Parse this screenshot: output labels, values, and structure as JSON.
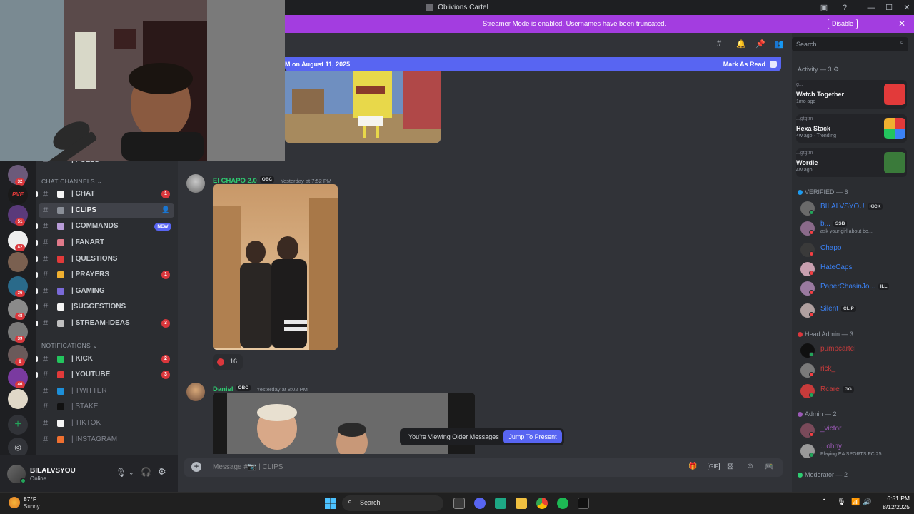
{
  "window": {
    "title": "Oblivions Cartel"
  },
  "banner": {
    "text": "Streamer Mode is enabled. Usernames have been truncated.",
    "disable_label": "Disable"
  },
  "search": {
    "placeholder": "Search"
  },
  "newbar": {
    "text": "M on August 11, 2025",
    "mark_label": "Mark As Read"
  },
  "channels": {
    "categories": [
      {
        "label": "CHAT CHANNELS ⌄"
      },
      {
        "label": "NOTIFICATIONS ⌄"
      }
    ],
    "partial_top": "| POLLS",
    "items": [
      {
        "label": "| CHAT",
        "badge": "1",
        "emoji_color": "#f5f5f5"
      },
      {
        "label": "| CLIPS",
        "emoji_color": "#8a8f98"
      },
      {
        "label": "| COMMANDS",
        "new": "NEW",
        "emoji_color": "#b89cd8"
      },
      {
        "label": "| FANART",
        "emoji_color": "#e07a8a"
      },
      {
        "label": "| QUESTIONS",
        "emoji_color": "#e23a3a"
      },
      {
        "label": "| PRAYERS",
        "badge": "1",
        "emoji_color": "#f0b030"
      },
      {
        "label": "| GAMING",
        "emoji_color": "#7a6ad8"
      },
      {
        "label": "|SUGGESTIONS",
        "emoji_color": "#f5f5f5"
      },
      {
        "label": "| STREAM-IDEAS",
        "badge": "3",
        "emoji_color": "#c0c0c0"
      },
      {
        "label": "| KICK",
        "badge": "2",
        "emoji_color": "#23c55e"
      },
      {
        "label": "| YOUTUBE",
        "badge": "3",
        "emoji_color": "#e23a3a"
      },
      {
        "label": "| TWITTER",
        "emoji_color": "#1d8fd8"
      },
      {
        "label": "| STAKE",
        "emoji_color": "#111111"
      },
      {
        "label": "| TIKTOK",
        "emoji_color": "#f5f5f5"
      },
      {
        "label": "| INSTAGRAM",
        "emoji_color": "#f07030"
      }
    ]
  },
  "servers": [
    {
      "badge": "32",
      "color": "#6b5a7a"
    },
    {
      "badge": "",
      "color": "#1a1a1a",
      "text": "PVE"
    },
    {
      "badge": "51",
      "color": "#5a3a7a"
    },
    {
      "badge": "82",
      "color": "#eeeeee"
    },
    {
      "badge": "",
      "color": "#7a6050"
    },
    {
      "badge": "36",
      "color": "#2a6a8a"
    },
    {
      "badge": "48",
      "color": "#8a8a8a"
    },
    {
      "badge": "39",
      "color": "#7a7a7a"
    },
    {
      "badge": "8",
      "color": "#6a5a5a"
    },
    {
      "badge": "46",
      "color": "#7a3aa0"
    },
    {
      "badge": "",
      "color": "#e0d8c8"
    }
  ],
  "user": {
    "name": "BILALVSYOU",
    "status": "Online"
  },
  "messages": [
    {
      "author": "El CHAPO 2.0",
      "tag": "OBC",
      "timestamp": "Yesterday at 7:52 PM",
      "reaction_count": "16"
    },
    {
      "author": "Daniel",
      "tag": "OBC",
      "timestamp": "Yesterday at 8:02 PM"
    }
  ],
  "older": {
    "text": "You're Viewing Older Messages",
    "jump_label": "Jump To Present"
  },
  "composer": {
    "placeholder": "Message #📷 | CLIPS"
  },
  "members": {
    "activity_header": "Activity — 3 ⚙",
    "activities": [
      {
        "user": "g...",
        "name": "Watch Together",
        "meta": "1mo ago"
      },
      {
        "user": "...gtgtm",
        "name": "Hexa Stack",
        "meta": "4w ago · Trending"
      },
      {
        "user": "...gtgtm",
        "name": "Wordle",
        "meta": "4w ago"
      }
    ],
    "sections": [
      {
        "label": "VERIFIED — 6",
        "color": "#1d9bf0"
      },
      {
        "label": "Head Admin — 3",
        "color": "#da373c"
      },
      {
        "label": "Admin — 2",
        "color": "#9b59b6"
      },
      {
        "label": "Moderator — 2",
        "color": "#2ecc71"
      }
    ],
    "list": [
      {
        "name": "BILALVSYOU",
        "tag": "KICK",
        "color": "#3b82f6",
        "status": "online"
      },
      {
        "name": "b...",
        "tag": "SSB",
        "sub": "ask your girl about bo...",
        "color": "#3b82f6",
        "status": "dnd"
      },
      {
        "name": "Chapo",
        "color": "#3b82f6",
        "status": "dnd"
      },
      {
        "name": "HateCaps",
        "color": "#3b82f6",
        "status": "dnd"
      },
      {
        "name": "PaperChasinJo...",
        "tag": "ILL",
        "color": "#3b82f6",
        "status": "dnd"
      },
      {
        "name": "Silent",
        "tag": "CLIP",
        "color": "#3b82f6",
        "status": "dnd"
      },
      {
        "name": "pumpcartel",
        "color": "#c73b3b",
        "status": "online"
      },
      {
        "name": "rick_",
        "color": "#c73b3b",
        "status": "dnd"
      },
      {
        "name": "Rcare",
        "tag": "GG",
        "color": "#c73b3b",
        "status": "online"
      },
      {
        "name": "_victor",
        "color": "#9b59b6",
        "status": "dnd"
      },
      {
        "name": "...ohny",
        "sub": "Playing EA SPORTS FC 25",
        "color": "#9b59b6",
        "status": "online"
      }
    ]
  },
  "taskbar": {
    "weather_temp": "87°F",
    "weather_desc": "Sunny",
    "search_label": "Search",
    "time": "6:51 PM",
    "date": "8/12/2025"
  }
}
